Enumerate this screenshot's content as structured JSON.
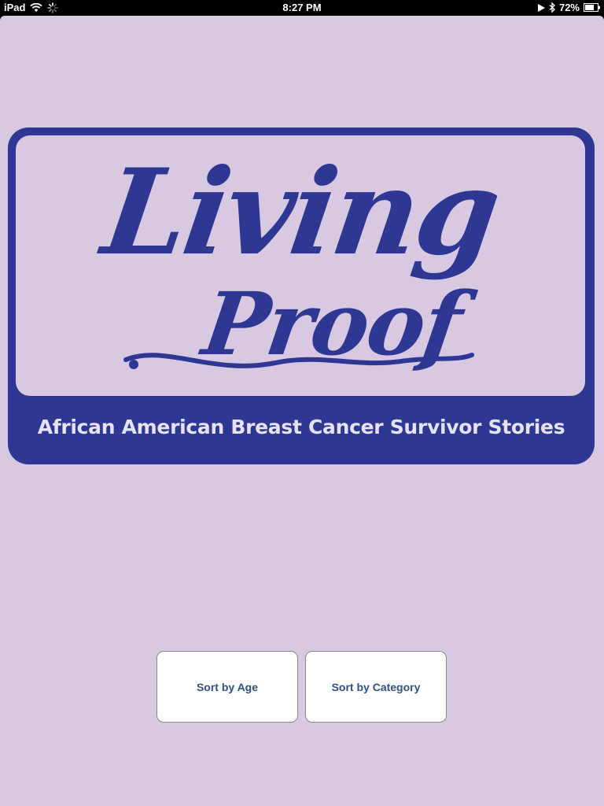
{
  "status_bar": {
    "device": "iPad",
    "time": "8:27 PM",
    "battery": "72%",
    "icons": [
      "wifi-icon",
      "activity-spinner-icon",
      "play-icon",
      "bluetooth-icon",
      "battery-icon"
    ]
  },
  "logo": {
    "line1": "Living",
    "line2": "Proof",
    "tagline": "African American Breast Cancer Survivor Stories"
  },
  "buttons": {
    "sort_by_age": "Sort by Age",
    "sort_by_category": "Sort by Category"
  },
  "colors": {
    "background": "#d9c8e2",
    "brand_blue": "#2e3893",
    "button_text": "#324f85"
  }
}
